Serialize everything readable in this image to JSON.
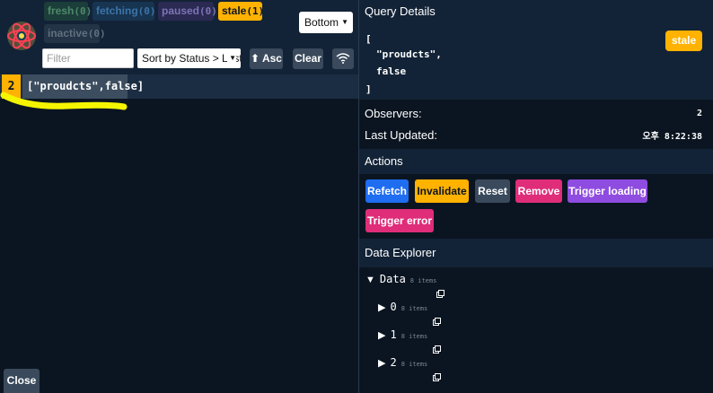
{
  "toolbar": {
    "logo_icon": "react-query-logo",
    "status_badges": [
      {
        "label": "fresh",
        "count": "(0)"
      },
      {
        "label": "fetching",
        "count": "(0)"
      },
      {
        "label": "paused",
        "count": "(0)"
      },
      {
        "label": "stale",
        "count": "(1)"
      },
      {
        "label": "inactive",
        "count": "(0)"
      }
    ],
    "position_select": "Bottom",
    "filter_placeholder": "Filter",
    "sort_select": "Sort by Status > Last Updated",
    "asc_label": "⬆ Asc",
    "clear_label": "Clear",
    "wifi_icon": "wifi-icon"
  },
  "query_list": [
    {
      "observers": "2",
      "key": "[\"proudcts\",false]"
    }
  ],
  "close_label": "Close",
  "details": {
    "header": "Query Details",
    "code_lines": [
      "[",
      "\"proudcts\",",
      "false",
      "]"
    ],
    "status": "stale",
    "observers_label": "Observers:",
    "observers_value": "2",
    "last_updated_label": "Last Updated:",
    "last_updated_value": "오후 8:22:38"
  },
  "actions": {
    "header": "Actions",
    "buttons": [
      "Refetch",
      "Invalidate",
      "Reset",
      "Remove",
      "Trigger loading",
      "Trigger error"
    ]
  },
  "explorer": {
    "header": "Data Explorer",
    "items": [
      {
        "name": "Data",
        "count": "8 items",
        "expanded": true
      },
      {
        "name": "0",
        "count": "8 items",
        "expanded": false
      },
      {
        "name": "1",
        "count": "8 items",
        "expanded": false
      },
      {
        "name": "2",
        "count": "8 items",
        "expanded": false
      }
    ]
  },
  "colors": {
    "background": "#0b1521",
    "panel": "#132337",
    "stale": "#ffb200",
    "refetch": "#1f6df0",
    "remove": "#df2d7a",
    "trigger_loading": "#8f4ce0",
    "annotation": "#f5f500"
  }
}
